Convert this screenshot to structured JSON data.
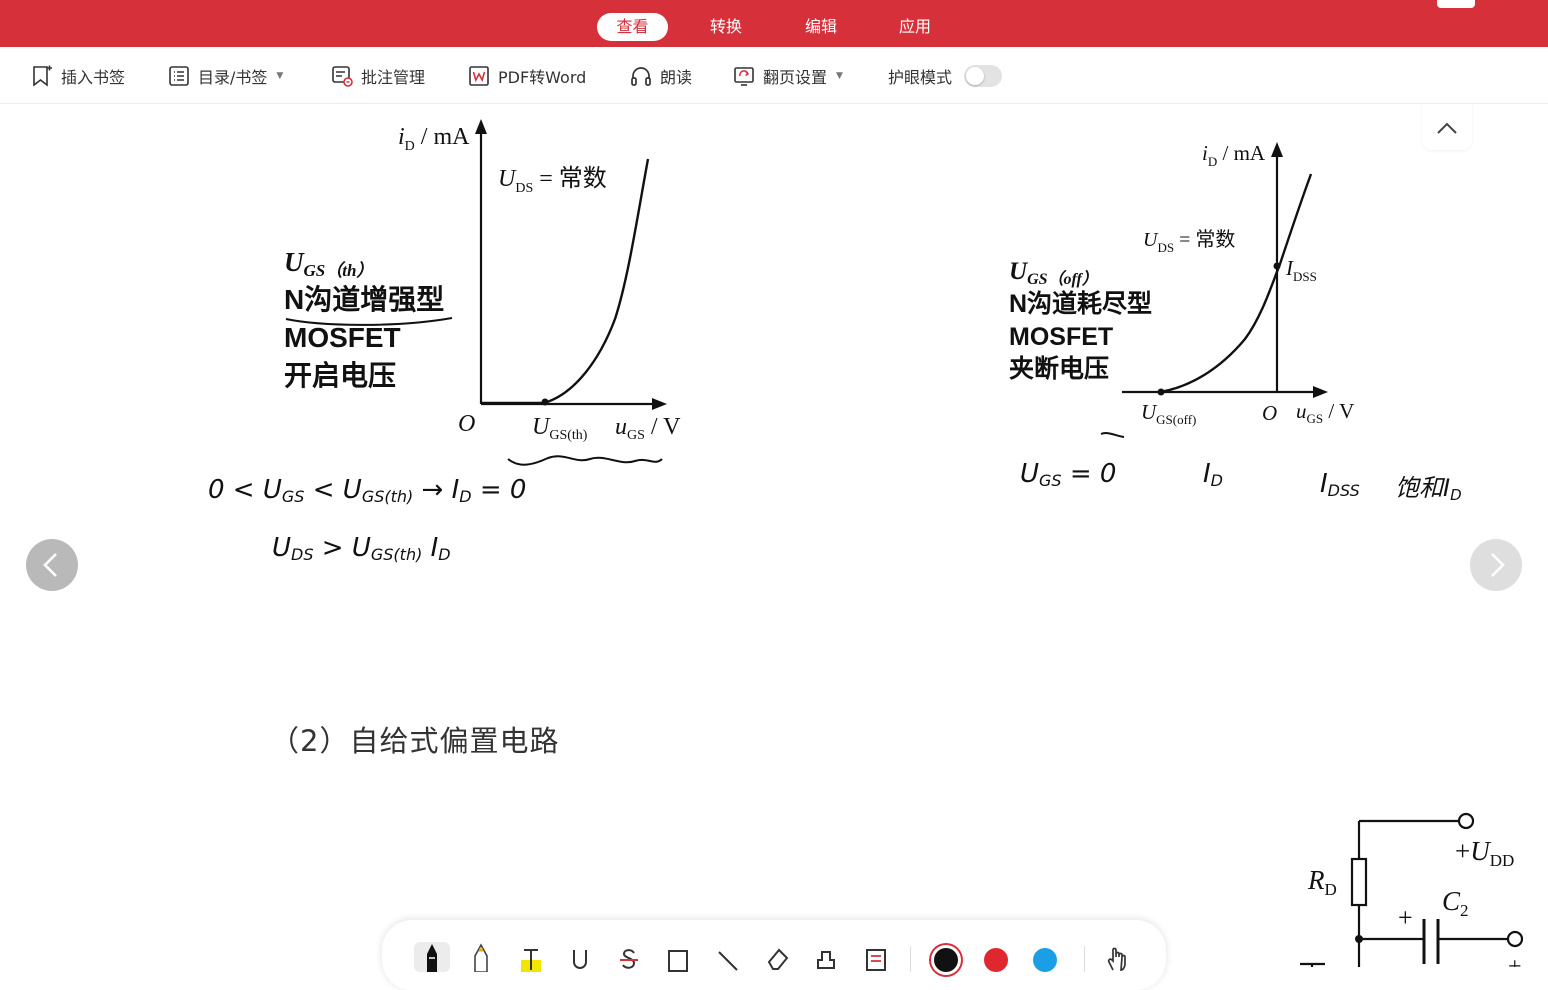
{
  "top_tabs": [
    {
      "label": "查看",
      "active": true
    },
    {
      "label": "转换",
      "active": false
    },
    {
      "label": "编辑",
      "active": false
    },
    {
      "label": "应用",
      "active": false
    }
  ],
  "toolbar": {
    "insert_bookmark": "插入书签",
    "toc_bookmark": "目录/书签",
    "annotation_manage": "批注管理",
    "pdf_to_word": "PDF转Word",
    "read_aloud": "朗读",
    "page_settings": "翻页设置",
    "eye_mode": "护眼模式",
    "eye_mode_on": false
  },
  "left_figure": {
    "y_axis_label": "i",
    "y_axis_sub": "D",
    "y_axis_unit": " / mA",
    "x_axis_label": "u",
    "x_axis_sub": "GS",
    "x_axis_unit": " / V",
    "origin": "O",
    "threshold_label": "U",
    "threshold_sub": "GS(th)",
    "uds_label": "U",
    "uds_sub": "DS",
    "uds_value": " = 常数",
    "title_symbol": "U",
    "title_symbol_sub": "GS（th）",
    "title_line1": "N沟道增强型",
    "title_line2": "MOSFET",
    "title_line3": "开启电压",
    "note_line1_parts": [
      "0 < U",
      "GS",
      " < U",
      "GS(th)",
      "  →  I",
      "D",
      " = 0"
    ],
    "note_line2_parts": [
      "U",
      "DS",
      " > U",
      "GS(th)",
      "      I",
      "D"
    ]
  },
  "right_figure": {
    "y_axis_label": "i",
    "y_axis_sub": "D",
    "y_axis_unit": " / mA",
    "x_axis_label": "u",
    "x_axis_sub": "GS",
    "x_axis_unit": " / V",
    "origin": "O",
    "cutoff_label": "U",
    "cutoff_sub": "GS(off)",
    "uds_label": "U",
    "uds_sub": "DS",
    "uds_value": " = 常数",
    "idss_label": "I",
    "idss_sub": "DSS",
    "title_symbol": "U",
    "title_symbol_sub": "GS（off）",
    "title_line1": "N沟道耗尽型",
    "title_line2": "MOSFET",
    "title_line3": "夹断电压",
    "note_parts": [
      "U",
      "GS",
      " = 0",
      "I",
      "D",
      "I",
      "DSS",
      "饱和I",
      "D"
    ]
  },
  "section_heading": "（2）自给式偏置电路",
  "circuit": {
    "vdd_prefix": "+",
    "vdd_label": "U",
    "vdd_sub": "DD",
    "rd_label": "R",
    "rd_sub": "D",
    "c2_label": "C",
    "c2_sub": "2",
    "c2_plus": "+",
    "bottom_plus": "+"
  },
  "annotation_tools": [
    "pen-tool",
    "highlighter-tool",
    "text-highlight-tool",
    "underline-tool",
    "strikethrough-tool",
    "rectangle-tool",
    "line-tool",
    "eraser-tool",
    "stamp-tool",
    "note-tool"
  ],
  "pen_colors": [
    "#111111",
    "#e0262e",
    "#1a9ee6"
  ],
  "colors": {
    "brand_red": "#d6303a",
    "selected_color_ring": "#111111"
  }
}
